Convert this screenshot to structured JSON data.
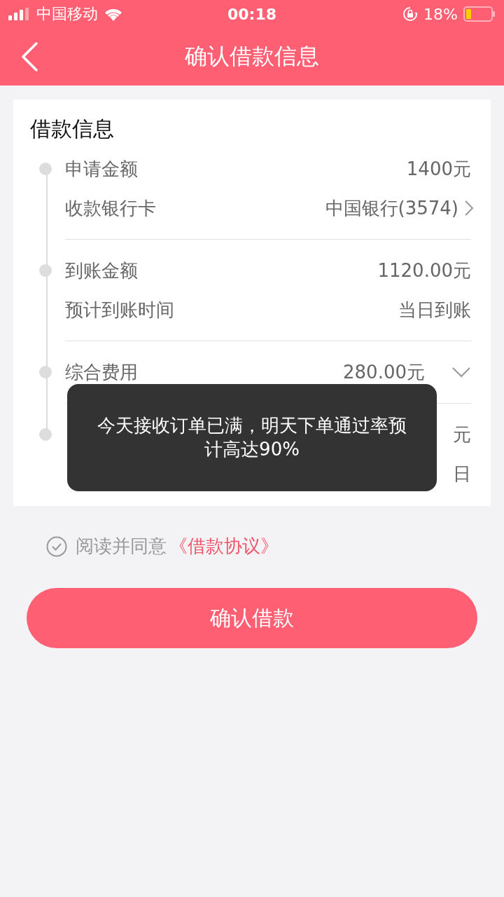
{
  "status_bar": {
    "carrier": "中国移动",
    "time": "00:18",
    "battery": "18%"
  },
  "nav": {
    "title": "确认借款信息"
  },
  "card": {
    "title": "借款信息",
    "sections": [
      {
        "rows": [
          {
            "label": "申请金额",
            "value": "1400元",
            "kind": "plain"
          },
          {
            "label": "收款银行卡",
            "value": "中国银行(3574)",
            "kind": "link"
          }
        ]
      },
      {
        "rows": [
          {
            "label": "到账金额",
            "value": "1120.00元",
            "kind": "plain"
          },
          {
            "label": "预计到账时间",
            "value": "当日到账",
            "kind": "plain"
          }
        ]
      },
      {
        "rows": [
          {
            "label": "综合费用",
            "value": "280.00元",
            "kind": "expandable",
            "expanded": false
          }
        ]
      },
      {
        "rows": [
          {
            "value": "元",
            "kind": "plain"
          },
          {
            "value": "日",
            "kind": "plain"
          }
        ]
      }
    ]
  },
  "agreement": {
    "checked": false,
    "text": "阅读并同意",
    "link": "《借款协议》"
  },
  "confirm_button": "确认借款",
  "toast": "今天接收订单已满，明天下单通过率预计高达90%"
}
